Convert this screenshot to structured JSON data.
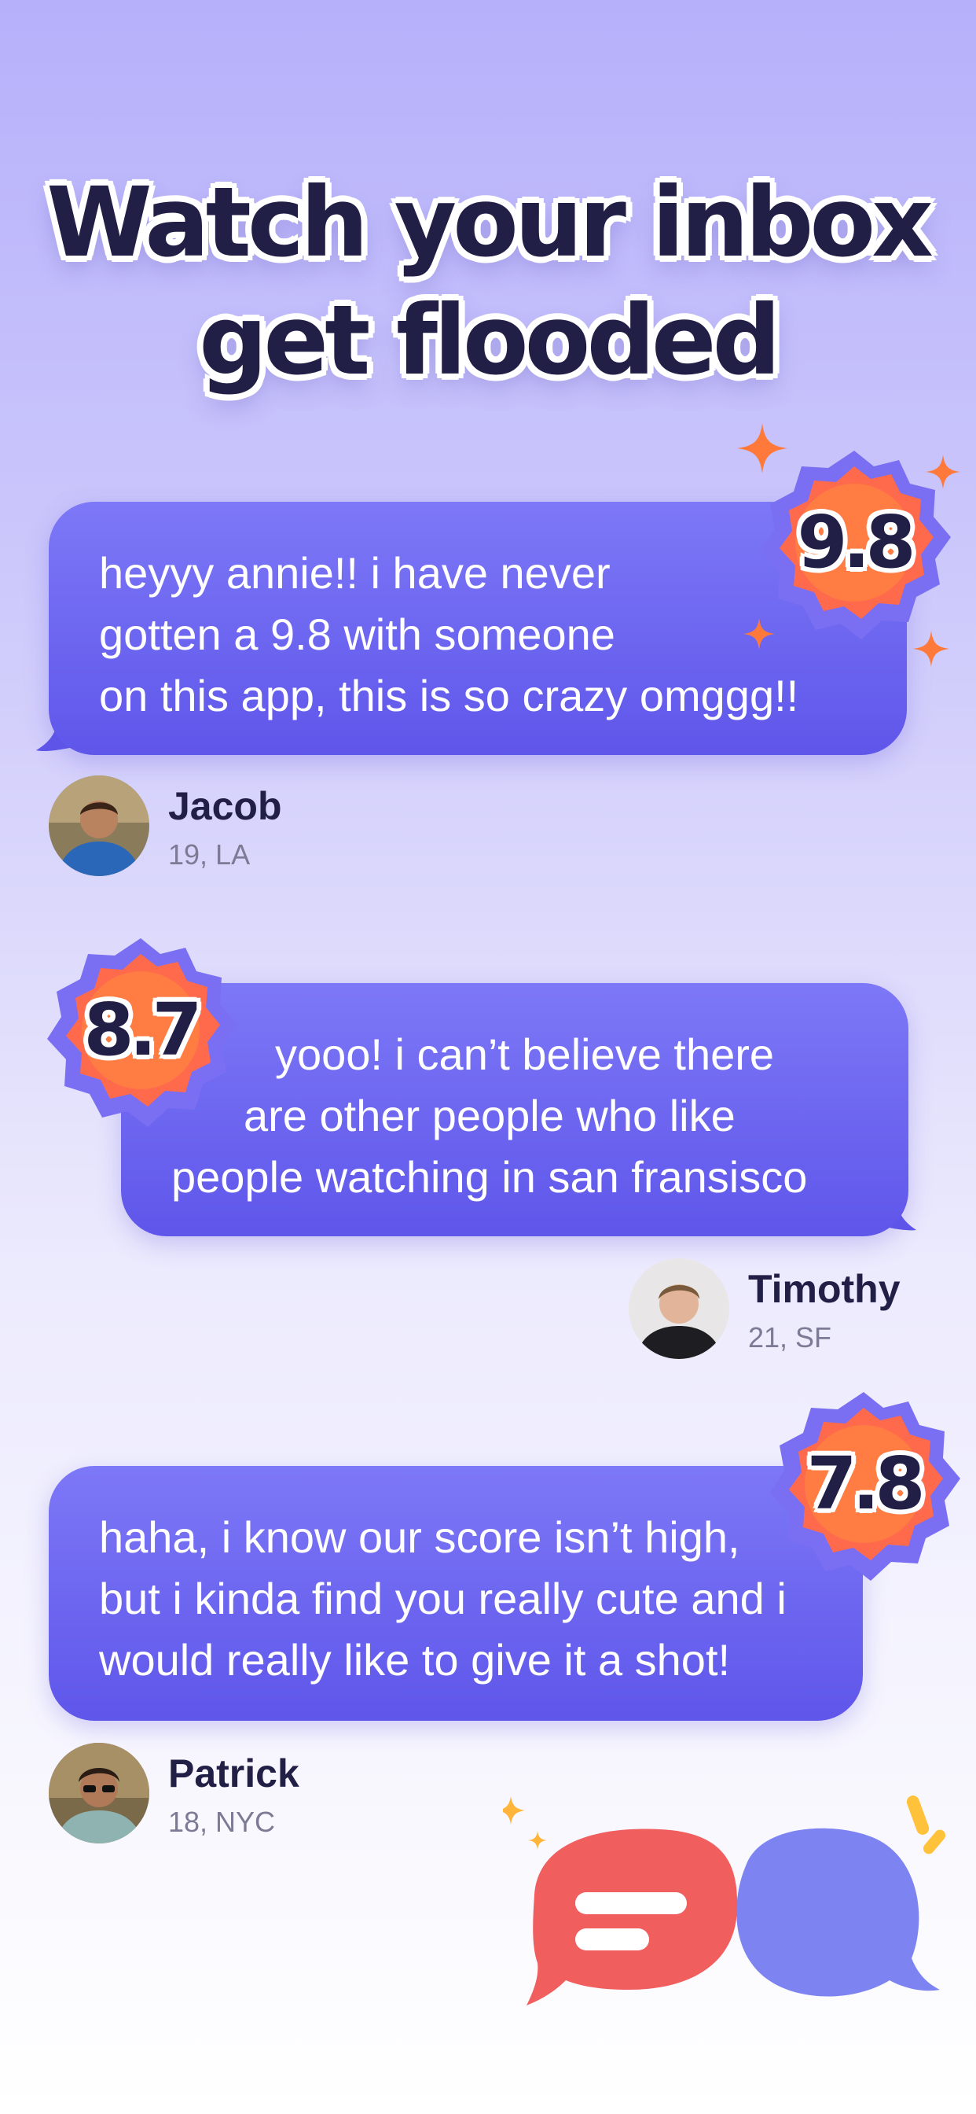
{
  "headline": {
    "line1": "Watch your inbox",
    "line2": "get flooded"
  },
  "messages": [
    {
      "score": "9.8",
      "lines": [
        "heyyy annie!! i have never",
        "gotten a 9.8 with someone",
        "on this app, this is so crazy omggg!!"
      ],
      "user": {
        "name": "Jacob",
        "meta": "19, LA"
      }
    },
    {
      "score": "8.7",
      "lines": [
        "yooo! i can’t believe there",
        "are other people who like",
        "people watching in san fransisco"
      ],
      "user": {
        "name": "Timothy",
        "meta": "21, SF"
      }
    },
    {
      "score": "7.8",
      "lines": [
        "haha, i know our score isn’t high,",
        "but i kinda find you really cute and i",
        "would really like to give it a shot!"
      ],
      "user": {
        "name": "Patrick",
        "meta": "18, NYC"
      }
    }
  ],
  "colors": {
    "bubble_top": "#7d78f7",
    "bubble_bottom": "#5f56ea",
    "badge_fill": "#ff6a4d",
    "badge_ring": "#7a6ff2",
    "headline": "#221f47",
    "sparkle": "#ff7a3a"
  }
}
